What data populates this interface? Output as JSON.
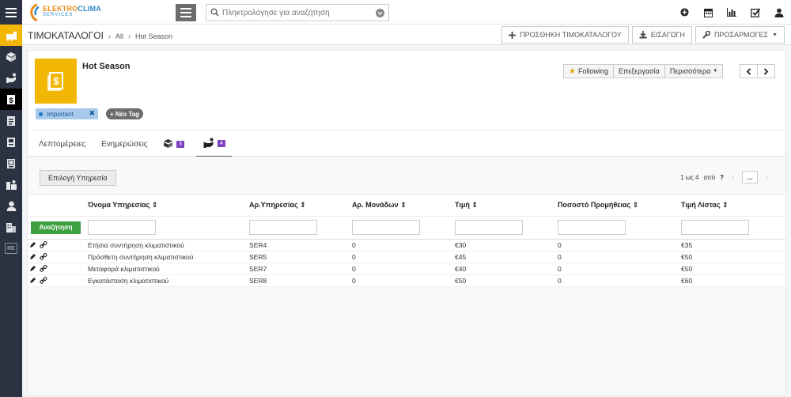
{
  "topbar": {
    "logo_text_a": "ELEKTRO",
    "logo_text_b": "CLIMA",
    "logo_sub": "SERVICES",
    "search_placeholder": "Πληκτρολόγησε για αναζήτηση",
    "icons": [
      "plus-circle-icon",
      "calendar-icon",
      "bar-chart-icon",
      "checkbox-icon",
      "user-menu-icon"
    ]
  },
  "sidebar": {
    "items": [
      "quick-create-icon",
      "box-icon",
      "hand-coin-icon",
      "price-list-icon",
      "contacts-icon",
      "address-book-icon",
      "calendar-book-icon",
      "worker-icon",
      "user-icon",
      "building-icon"
    ],
    "re_label": "RE"
  },
  "breadcrumb": {
    "root": "ΤΙΜΟΚΑΤΑΛΟΓΟΙ",
    "all": "All",
    "current": "Hot Season"
  },
  "actions": {
    "add": "ΠΡΟΣΘΗΚΗ ΤΙΜΟΚΑΤΑΛΟΓΟΥ",
    "import": "ΕΙΣΑΓΩΓΗ",
    "customize": "ΠΡΟΣΑΡΜΟΓΕΣ"
  },
  "record": {
    "title": "Hot Season",
    "tag": "Important",
    "new_tag": "Νέο Tag",
    "following": "Following",
    "edit": "Επεξεργασία",
    "more": "Περισσότερα"
  },
  "tabs": {
    "details": "Λεπτομέρειες",
    "updates": "Ενημερώσεις",
    "products_count": "3",
    "services_count": "4"
  },
  "list": {
    "select_button": "Επιλογή Υπηρεσία",
    "pager_text": "1 ως 4",
    "pager_of": "από",
    "pager_total": "?",
    "pager_more": "…",
    "search_button": "Αναζήτηση",
    "columns": [
      "Όνομα Υπηρεσίας",
      "Αρ.Υπηρεσίας",
      "Αρ. Μονάδων",
      "Τιμή",
      "Ποσοστό Προμήθειας",
      "Τιμή Λίστας"
    ],
    "rows": [
      {
        "name": "Ετήσια συντήρηση κλιματιστικού",
        "code": "SER4",
        "units": "0",
        "price": "€30",
        "commission": "0",
        "list_price": "€35"
      },
      {
        "name": "Πρόσθετη συντήρηση κλιματιστικού",
        "code": "SER5",
        "units": "0",
        "price": "€45",
        "commission": "0",
        "list_price": "€50"
      },
      {
        "name": "Μεταφορά κλιματιστικού",
        "code": "SER7",
        "units": "0",
        "price": "€40",
        "commission": "0",
        "list_price": "€50"
      },
      {
        "name": "Εγκατάσταση κλιματιστικού",
        "code": "SER8",
        "units": "0",
        "price": "€50",
        "commission": "0",
        "list_price": "€60"
      }
    ]
  }
}
